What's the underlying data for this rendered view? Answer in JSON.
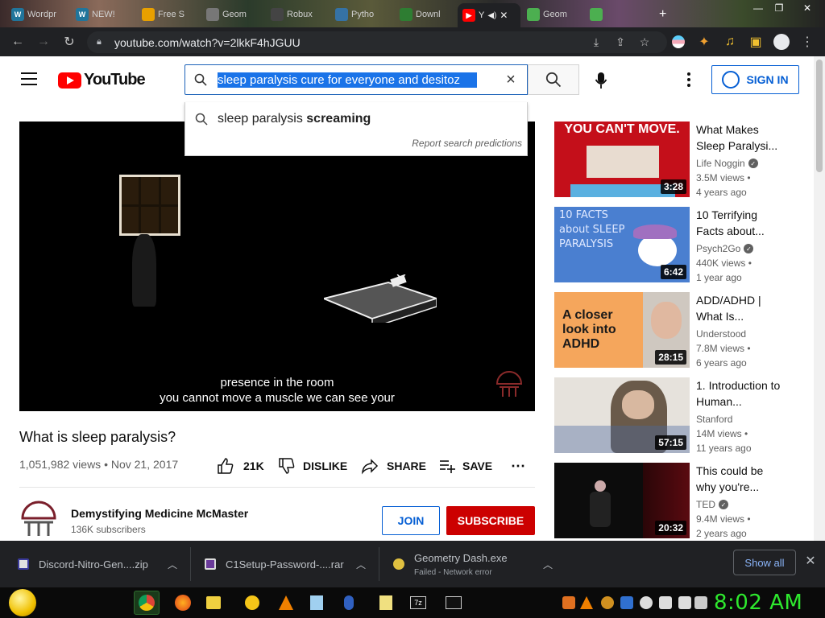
{
  "browser": {
    "tabs": [
      {
        "label": "Wordpr"
      },
      {
        "label": "NEW!"
      },
      {
        "label": "Free S"
      },
      {
        "label": "Geom"
      },
      {
        "label": "Robux"
      },
      {
        "label": "Pytho"
      },
      {
        "label": "Downl"
      },
      {
        "label": "Y"
      },
      {
        "label": "Geom"
      }
    ],
    "url": "youtube.com/watch?v=2lkkF4hJGUU",
    "colors": {
      "toolbar": "#202124",
      "tab_accent": "#ff0000"
    }
  },
  "youtube": {
    "logo_text": "YouTube",
    "search_query": "sleep paralysis cure for everyone and desitoz",
    "sign_in_label": "SIGN IN",
    "suggestion": {
      "prefix": "sleep paralysis ",
      "bold": "screaming"
    },
    "report_predictions": "Report search predictions"
  },
  "player": {
    "subtitle_line1": "presence in the room",
    "subtitle_line2": "you cannot move a muscle we can see your"
  },
  "video": {
    "title": "What is sleep paralysis?",
    "stats": "1,051,982 views • Nov 21, 2017",
    "likes": "21K",
    "dislike_label": "DISLIKE",
    "share_label": "SHARE",
    "save_label": "SAVE",
    "channel_name": "Demystifying Medicine McMaster",
    "channel_subs": "136K subscribers",
    "join_label": "JOIN",
    "subscribe_label": "SUBSCRIBE"
  },
  "related": [
    {
      "thumb_text": "YOU CAN'T MOVE.",
      "duration": "3:28",
      "title": "What Makes Sleep Paralysi...",
      "channel": "Life Noggin",
      "views": "3.5M views •",
      "age": "4 years ago",
      "verified": true
    },
    {
      "thumb_text": "10 FACTS about SLEEP PARALYSIS",
      "duration": "6:42",
      "title": "10 Terrifying Facts about...",
      "channel": "Psych2Go",
      "views": "440K views •",
      "age": "1 year ago",
      "verified": true
    },
    {
      "thumb_text": "A closer look into ADHD",
      "duration": "28:15",
      "title": "ADD/ADHD | What Is...",
      "channel": "Understood",
      "views": "7.8M views •",
      "age": "6 years ago",
      "verified": false
    },
    {
      "thumb_text": "",
      "duration": "57:15",
      "title": "1. Introduction to Human...",
      "channel": "Stanford",
      "views": "14M views •",
      "age": "11 years ago",
      "verified": false
    },
    {
      "thumb_text": "",
      "duration": "20:32",
      "title": "This could be why you're...",
      "channel": "TED",
      "views": "9.4M views •",
      "age": "2 years ago",
      "verified": true
    }
  ],
  "downloads": {
    "items": [
      {
        "name": "Discord-Nitro-Gen....zip",
        "status": ""
      },
      {
        "name": "C1Setup-Password-....rar",
        "status": ""
      },
      {
        "name": "Geometry Dash.exe",
        "status": "Failed - Network error"
      }
    ],
    "show_all_label": "Show all"
  },
  "taskbar": {
    "clock": "8:02 AM",
    "clock_color": "#2ee82e"
  }
}
